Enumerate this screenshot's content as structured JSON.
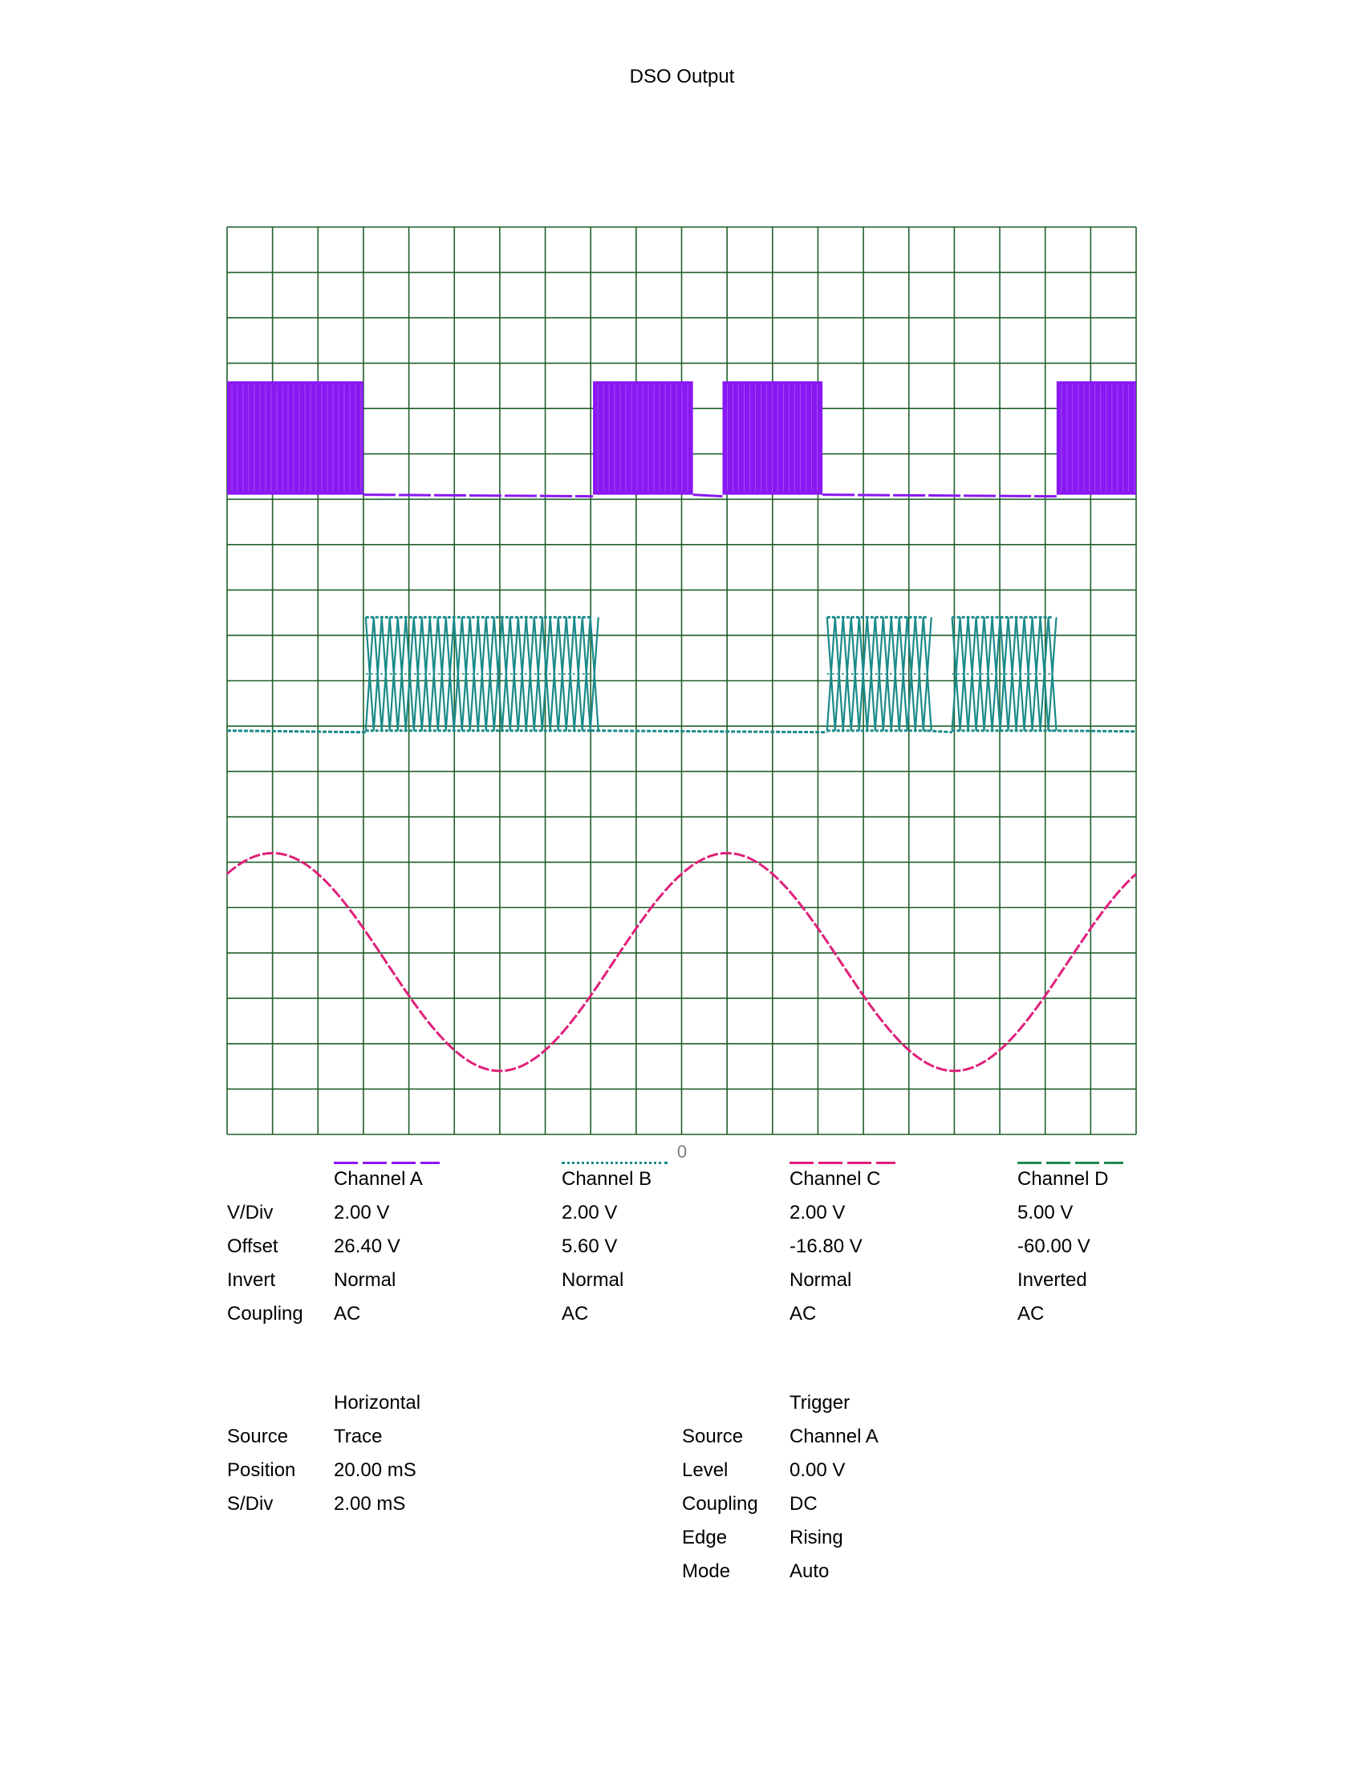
{
  "title": "DSO Output",
  "zero_marker": "0",
  "chart_data": {
    "type": "line",
    "title": "DSO Output",
    "x_unit": "ms",
    "grid": true,
    "grid_divisions": {
      "horizontal": 20,
      "vertical": 20
    },
    "grid_color": "#1f5f2a",
    "series": [
      {
        "name": "Channel A",
        "color": "#8a18f2",
        "kind": "burst",
        "high_div": 3.4,
        "low_div": 5.9,
        "bursts_ms": [
          [
            0,
            6.0
          ],
          [
            16.1,
            20.5
          ],
          [
            21.8,
            26.2
          ],
          [
            36.5,
            40.0
          ]
        ],
        "gaps_pattern": "square-bursts"
      },
      {
        "name": "Channel B",
        "color": "#1a8a8a",
        "kind": "burst",
        "high_div": 8.6,
        "low_div": 11.1,
        "bursts_ms": [
          [
            6.1,
            16.0
          ],
          [
            26.4,
            30.8
          ],
          [
            31.9,
            36.3
          ]
        ],
        "gaps_pattern": "diamond-bursts"
      },
      {
        "name": "Channel C",
        "color": "#e0207a",
        "kind": "sine",
        "period_ms": 20.0,
        "peak_at_ms": 2.0,
        "max_div": 13.8,
        "min_div": 18.6
      }
    ]
  },
  "channels": {
    "labels": [
      "V/Div",
      "Offset",
      "Invert",
      "Coupling"
    ],
    "items": [
      {
        "name": "Channel A",
        "color": "#8a18f2",
        "vdiv": "2.00 V",
        "offset": "26.40 V",
        "invert": "Normal",
        "coupling": "AC"
      },
      {
        "name": "Channel B",
        "color": "#1a8a8a",
        "vdiv": "2.00 V",
        "offset": "5.60 V",
        "invert": "Normal",
        "coupling": "AC"
      },
      {
        "name": "Channel C",
        "color": "#e0207a",
        "vdiv": "2.00 V",
        "offset": "-16.80 V",
        "invert": "Normal",
        "coupling": "AC"
      },
      {
        "name": "Channel D",
        "color": "#1e8a50",
        "vdiv": "5.00 V",
        "offset": "-60.00 V",
        "invert": "Inverted",
        "coupling": "AC"
      }
    ]
  },
  "horizontal": {
    "heading": "Horizontal",
    "labels": [
      "Source",
      "Position",
      "S/Div"
    ],
    "values": [
      "Trace",
      "20.00 mS",
      "2.00 mS"
    ]
  },
  "trigger": {
    "heading": "Trigger",
    "labels": [
      "Source",
      "Level",
      "Coupling",
      "Edge",
      "Mode"
    ],
    "values": [
      "Channel A",
      "0.00 V",
      "DC",
      "Rising",
      "Auto"
    ]
  }
}
